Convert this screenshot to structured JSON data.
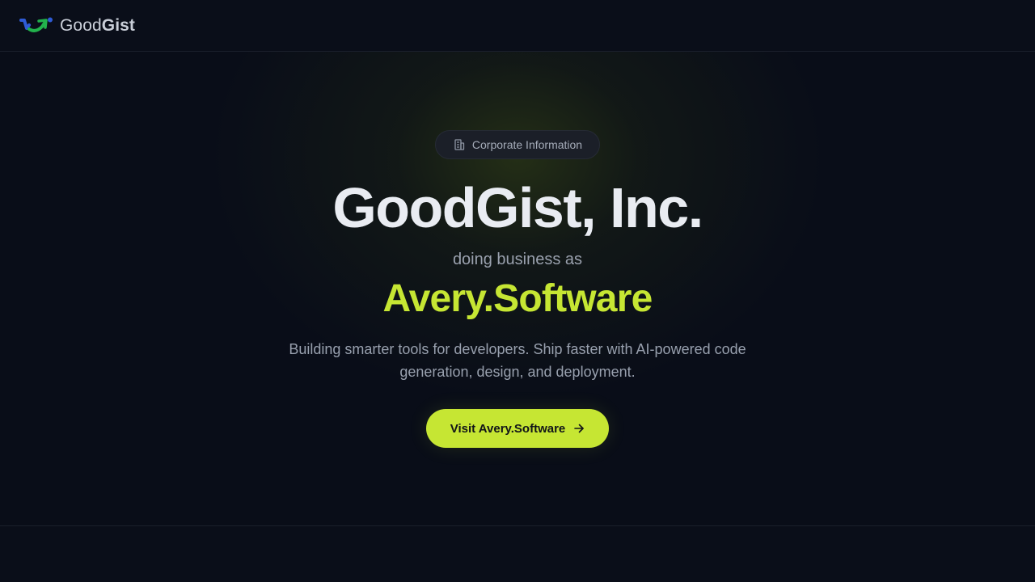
{
  "header": {
    "logo_light": "Good",
    "logo_bold": "Gist",
    "logo_icon": "goodgist-logo-icon"
  },
  "hero": {
    "badge_icon": "building-icon",
    "badge_label": "Corporate Information",
    "title": "GoodGist, Inc.",
    "dba_label": "doing business as",
    "brand_name": "Avery.Software",
    "description": "Building smarter tools for developers. Ship faster with AI-powered code generation, design, and deployment.",
    "cta_label": "Visit Avery.Software",
    "cta_icon": "arrow-right-icon"
  },
  "colors": {
    "background": "#090d18",
    "accent": "#c6e633",
    "logo_blue": "#2f5bd6",
    "logo_green": "#22b14c"
  }
}
